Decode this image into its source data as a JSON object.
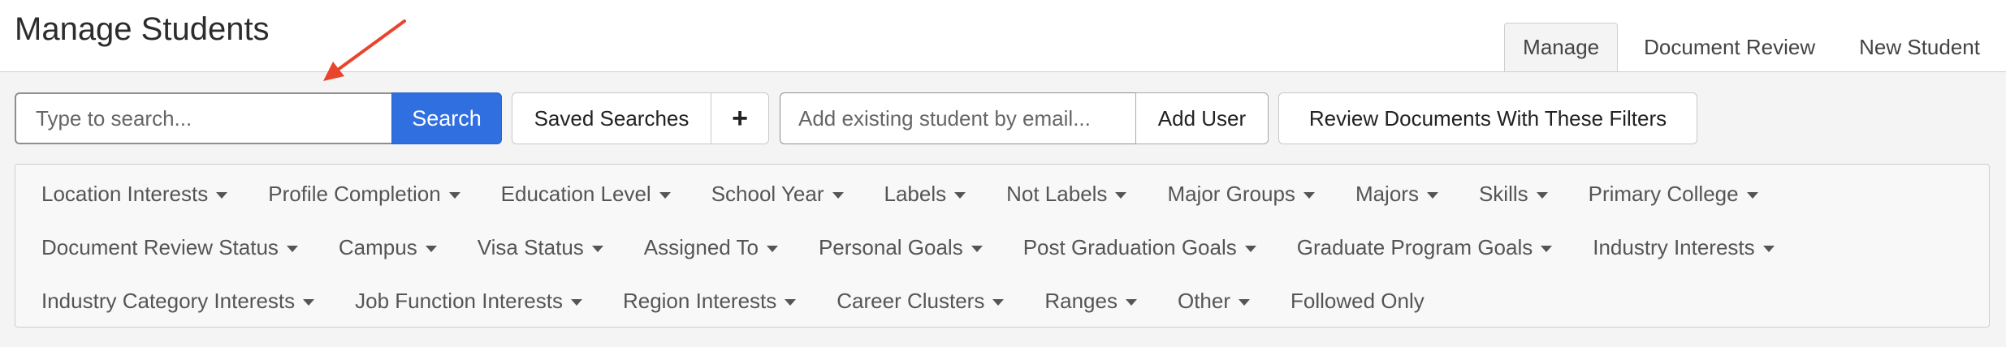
{
  "page": {
    "title": "Manage Students"
  },
  "tabs": [
    {
      "label": "Manage",
      "active": true
    },
    {
      "label": "Document Review",
      "active": false
    },
    {
      "label": "New Student",
      "active": false
    }
  ],
  "toolbar": {
    "search_placeholder": "Type to search...",
    "search_button": "Search",
    "saved_searches_button": "Saved Searches",
    "plus_button": "+",
    "email_placeholder": "Add existing student by email...",
    "add_user_button": "Add User",
    "review_button": "Review Documents With These Filters"
  },
  "filters": {
    "row1": [
      {
        "label": "Location Interests",
        "caret": true
      },
      {
        "label": "Profile Completion",
        "caret": true
      },
      {
        "label": "Education Level",
        "caret": true
      },
      {
        "label": "School Year",
        "caret": true
      },
      {
        "label": "Labels",
        "caret": true
      },
      {
        "label": "Not Labels",
        "caret": true
      },
      {
        "label": "Major Groups",
        "caret": true
      },
      {
        "label": "Majors",
        "caret": true
      },
      {
        "label": "Skills",
        "caret": true
      },
      {
        "label": "Primary College",
        "caret": true
      }
    ],
    "row2": [
      {
        "label": "Document Review Status",
        "caret": true
      },
      {
        "label": "Campus",
        "caret": true
      },
      {
        "label": "Visa Status",
        "caret": true
      },
      {
        "label": "Assigned To",
        "caret": true
      },
      {
        "label": "Personal Goals",
        "caret": true
      },
      {
        "label": "Post Graduation Goals",
        "caret": true
      },
      {
        "label": "Graduate Program Goals",
        "caret": true
      },
      {
        "label": "Industry Interests",
        "caret": true
      }
    ],
    "row3": [
      {
        "label": "Industry Category Interests",
        "caret": true
      },
      {
        "label": "Job Function Interests",
        "caret": true
      },
      {
        "label": "Region Interests",
        "caret": true
      },
      {
        "label": "Career Clusters",
        "caret": true
      },
      {
        "label": "Ranges",
        "caret": true
      },
      {
        "label": "Other",
        "caret": true
      },
      {
        "label": "Followed Only",
        "caret": false
      }
    ]
  },
  "colors": {
    "accent": "#2f6fe0",
    "annotation_arrow": "#e8452c"
  }
}
